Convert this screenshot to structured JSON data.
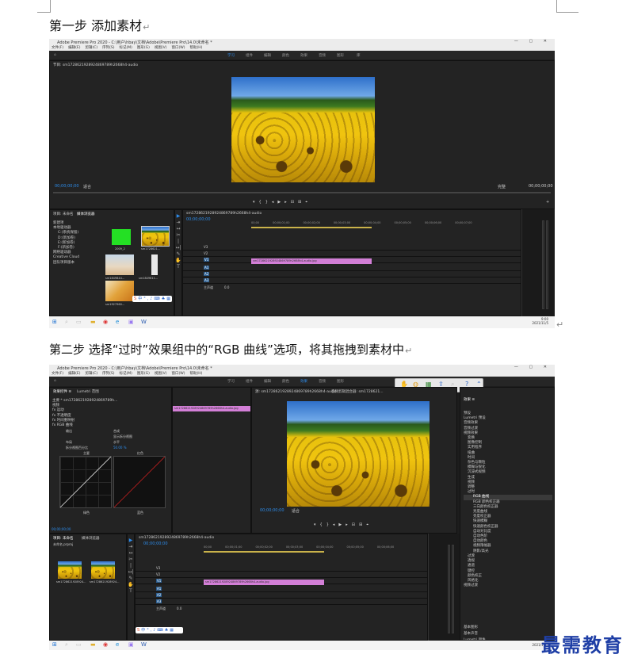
{
  "step1": {
    "heading": "第一步  添加素材"
  },
  "step2": {
    "heading": "第二步  选择“过时”效果组中的“RGB 曲线”选项，将其拖拽到素材中"
  },
  "return_mark": "↵",
  "app": {
    "title": "Adobe Premiere Pro 2020 - C:\\用户\\hbay\\文档\\Adobe\\Premiere Pro\\14.0\\未命名 *",
    "window_controls": "—  ▢  ✕",
    "menu": [
      "文件(F)",
      "编辑(E)",
      "剪辑(C)",
      "序列(S)",
      "标记(M)",
      "图形(G)",
      "视图(V)",
      "窗口(W)",
      "帮助(H)"
    ],
    "workspaces": [
      "学习",
      "组件",
      "编辑",
      "颜色",
      "效果",
      "音频",
      "图形",
      "库"
    ],
    "source_tab": "节目: sm1728621928924869789h2668h4-audio",
    "program_tab": "节目: sm1728621928924869789h2668h4-audio",
    "timecode_start": "00;00;00;00",
    "timecode_end": "00;00;00;00",
    "fit_label": "适合",
    "full_label": "完整",
    "project_tab": "项目: 未命名",
    "media_browser_tab": "媒体浏览器",
    "media_items": [
      "新建项",
      "本地驱动器",
      "C:(系统保留)",
      "D:(新加卷)",
      "E:(新加卷)",
      "F:(新加卷)",
      "网络驱动器",
      "Creative Cloud",
      "团队项目版本"
    ],
    "thumb_labels": [
      "2009_2",
      "sm1728621...",
      "sm1849844...",
      "sm1849611...",
      "sm1927960..."
    ],
    "sequence_tab": "sm1728621928924869789h2668h4-audio",
    "clip_name": "sm1728621928924869789h2668h4-audio.jpg",
    "ruler": [
      "00;00",
      "00;00;01;00",
      "00;00;02;00",
      "00;00;03;00",
      "00;00;04;00",
      "00;00;05;00",
      "00;00;06;00",
      "00;00;07;00",
      "00;00;08;00",
      "00;00;09;00"
    ],
    "tracks": [
      "V3",
      "V2",
      "V1",
      "A1",
      "A2",
      "A3"
    ],
    "master_label": "主声道",
    "master_value": "0.0",
    "clock_time": "9:00",
    "clock_date": "2021/11/5"
  },
  "app2": {
    "effect_controls_tab": "效果控件 ≡",
    "lumetri_tab": "Lumetri 范围",
    "source_tab": "源: sm1728621928924869789h2668h4-audio",
    "audio_mixer_tab": "音频剪辑混合器: sm1728621...",
    "effect_rows": [
      "主要 * sm1728621928924869789h...",
      "视频",
      "fx 运动",
      "fx 不透明度",
      "fx 时间重映射",
      "fx RGB 曲线"
    ],
    "output_label": "输出",
    "output_value": "合成",
    "show_split": "显示拆分视图",
    "layout_label": "布局",
    "layout_value": "水平",
    "split_percent_label": "拆分视图百分比",
    "split_percent_value": "50.00 %",
    "curve_labels": [
      "主要",
      "红色",
      "绿色",
      "蓝色"
    ],
    "effects_tab": "效果 ≡",
    "effects_list": [
      "预设",
      "Lumetri 预设",
      "音频效果",
      "音频过渡",
      "视频效果",
      "变换",
      "图像控制",
      "实用程序",
      "扭曲",
      "时间",
      "杂色与颗粒",
      "模糊与锐化",
      "沉浸式视频",
      "生成",
      "视频",
      "调整",
      "过时",
      "RGB 曲线",
      "RGB 颜色校正器",
      "三向颜色校正器",
      "亮度曲线",
      "亮度校正器",
      "快速模糊",
      "快速颜色校正器",
      "自动对比度",
      "自动色阶",
      "自动颜色",
      "视频限幅器",
      "阴影/高光",
      "过渡",
      "透视",
      "通道",
      "键控",
      "颜色校正",
      "风格化",
      "视频过渡"
    ],
    "essential_graphics": "基本图形",
    "essential_sound": "基本声音",
    "lumetri_color": "Lumetri 颜色",
    "project_tab": "项目: 未命名",
    "media_browser_tab": "媒体浏览器",
    "project_file": "未命名.prproj",
    "thumb_labels": [
      "sm1728621928924...",
      "sm1728621928924..."
    ],
    "fit_label": "适合",
    "timecode": "00;00;00;00",
    "clock_date": "2021/11/5"
  },
  "watermark": "最需教育",
  "colors": {
    "accent": "#2d8ceb",
    "clip": "#d37fd7",
    "watermark": "#1f3fa6"
  }
}
